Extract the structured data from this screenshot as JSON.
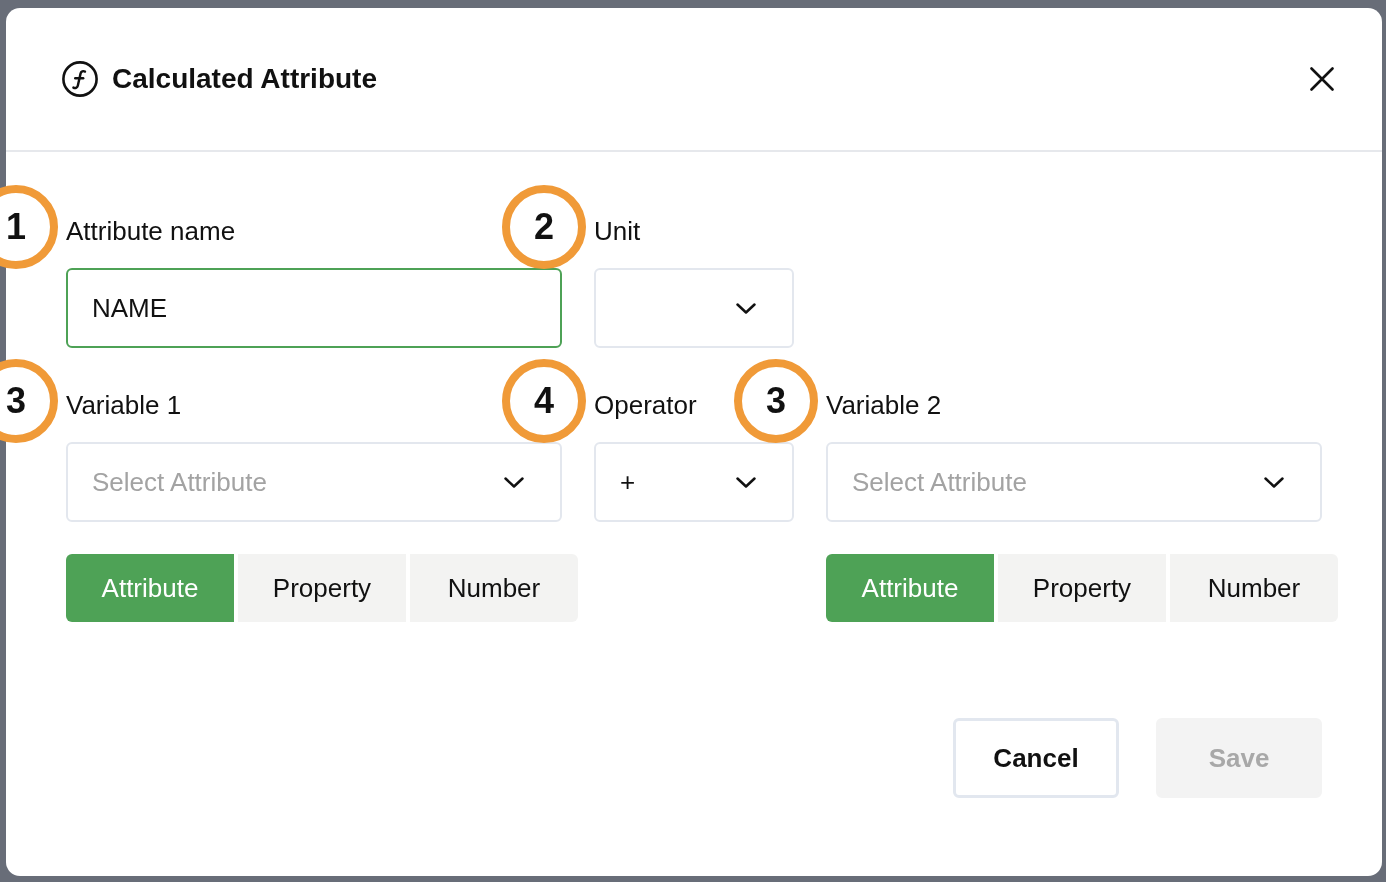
{
  "dialog": {
    "title": "Calculated Attribute"
  },
  "form": {
    "rows": [
      {
        "fields": [
          {
            "kind": "text",
            "label": "Attribute name",
            "callout": "1",
            "value": "NAME",
            "focused": true
          },
          {
            "kind": "select",
            "label": "Unit",
            "callout": "2",
            "focused": false
          }
        ]
      },
      {
        "fields": [
          {
            "kind": "select",
            "label": "Variable 1",
            "callout": "3",
            "placeholder": "Select Attribute",
            "focused": false,
            "sources": [
              {
                "label": "Attribute",
                "selected": true
              },
              {
                "label": "Property",
                "selected": false
              },
              {
                "label": "Number",
                "selected": false
              }
            ]
          },
          {
            "kind": "select",
            "label": "Operator",
            "callout": "4",
            "value": "+",
            "focused": false
          },
          {
            "kind": "select",
            "label": "Variable 2",
            "callout": "3",
            "placeholder": "Select Attribute",
            "focused": false,
            "sources": [
              {
                "label": "Attribute",
                "selected": true
              },
              {
                "label": "Property",
                "selected": false
              },
              {
                "label": "Number",
                "selected": false
              }
            ]
          }
        ]
      }
    ]
  },
  "buttons": [
    {
      "label": "Cancel",
      "kind": "secondary",
      "disabled": false
    },
    {
      "label": "Save",
      "kind": "primary",
      "disabled": true
    }
  ]
}
